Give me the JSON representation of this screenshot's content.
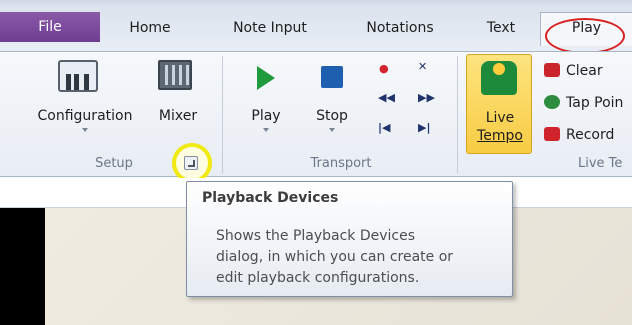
{
  "tabs": [
    {
      "label": "File"
    },
    {
      "label": "Home"
    },
    {
      "label": "Note Input"
    },
    {
      "label": "Notations"
    },
    {
      "label": "Text"
    },
    {
      "label": "Play",
      "active": true
    }
  ],
  "groups": {
    "setup": {
      "label": "Setup",
      "buttons": {
        "configuration": "Configuration",
        "mixer": "Mixer"
      },
      "launcher_icon": "dialog-launcher-icon"
    },
    "transport": {
      "label": "Transport",
      "buttons": {
        "play": "Play",
        "stop": "Stop"
      }
    },
    "live_tempo": {
      "label": "Live Te",
      "live_tempo_line1": "Live",
      "live_tempo_line2": "Tempo",
      "items": {
        "clear": "Clear",
        "tap_point": "Tap Poin",
        "record": "Record"
      }
    }
  },
  "tooltip": {
    "title": "Playback Devices",
    "body": "Shows the Playback Devices\ndialog, in which you can create or\nedit playback configurations."
  },
  "colors": {
    "file_tab": "#7a4a9c",
    "highlight_circle": "#d81f1f",
    "launcher_highlight": "#f0ea10",
    "live_tempo_bg": "#fbd65a"
  }
}
